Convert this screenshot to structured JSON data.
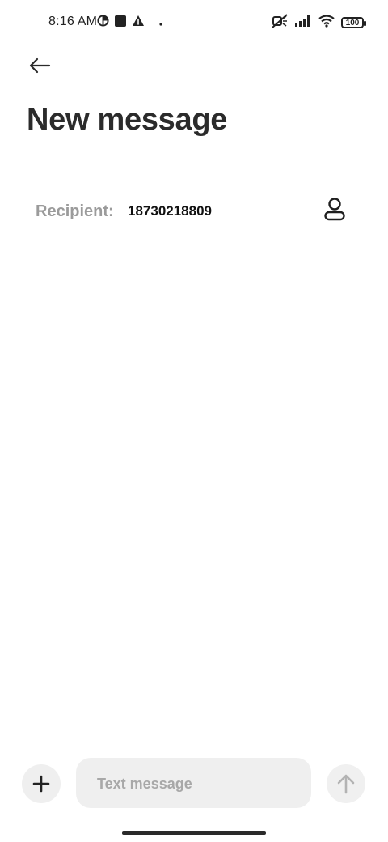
{
  "status_bar": {
    "time": "8:16 AM",
    "battery": "100",
    "left_icons": [
      "data-saver-icon",
      "square-icon",
      "warning-icon",
      "dot-icon"
    ],
    "right_icons": [
      "mute-icon",
      "signal-icon",
      "wifi-icon",
      "battery-icon"
    ]
  },
  "header": {
    "back_icon": "back-arrow-icon",
    "title": "New message"
  },
  "recipient": {
    "label": "Recipient:",
    "value": "18730218809",
    "contact_icon": "person-icon"
  },
  "compose": {
    "add_icon": "plus-icon",
    "placeholder": "Text message",
    "value": "",
    "send_icon": "arrow-up-icon"
  },
  "colors": {
    "background": "#ffffff",
    "title": "#2b2b2b",
    "label_gray": "#9b9b9b",
    "field_bg": "#efefef",
    "divider": "#d9d9d9"
  }
}
